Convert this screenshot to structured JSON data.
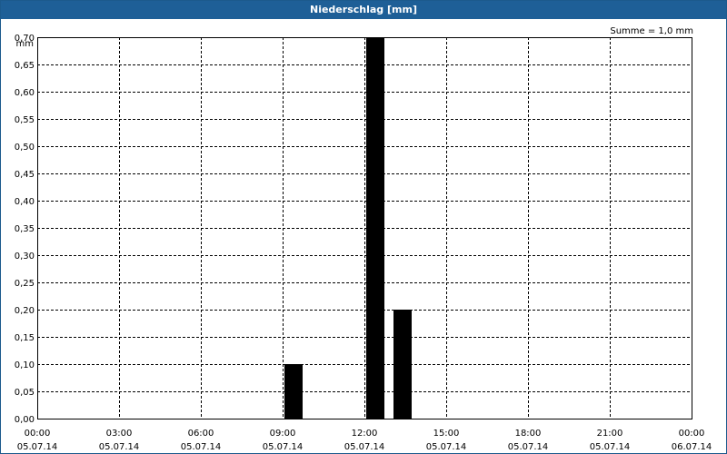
{
  "window": {
    "title": "Niederschlag [mm]"
  },
  "summary": "Summe = 1,0 mm",
  "colors": {
    "titlebar": "#1e5f97",
    "bars": "#000000",
    "grid": "#000000"
  },
  "chart_data": {
    "type": "bar",
    "title": "Niederschlag [mm]",
    "ylabel": "mm",
    "xlabel": "",
    "ylim": [
      0,
      0.7
    ],
    "xlim": [
      "05.07.14 00:00",
      "06.07.14 00:00"
    ],
    "grid": true,
    "yticks": [
      "0,00",
      "0,05",
      "0,10",
      "0,15",
      "0,20",
      "0,25",
      "0,30",
      "0,35",
      "0,40",
      "0,45",
      "0,50",
      "0,55",
      "0,60",
      "0,65",
      "0,70"
    ],
    "xticks": [
      {
        "time": "00:00",
        "date": "05.07.14"
      },
      {
        "time": "03:00",
        "date": "05.07.14"
      },
      {
        "time": "06:00",
        "date": "05.07.14"
      },
      {
        "time": "09:00",
        "date": "05.07.14"
      },
      {
        "time": "12:00",
        "date": "05.07.14"
      },
      {
        "time": "15:00",
        "date": "05.07.14"
      },
      {
        "time": "18:00",
        "date": "05.07.14"
      },
      {
        "time": "21:00",
        "date": "05.07.14"
      },
      {
        "time": "00:00",
        "date": "06.07.14"
      }
    ],
    "bars": [
      {
        "start": "05.07.14 09:00",
        "end": "05.07.14 10:00",
        "value": 0.1
      },
      {
        "start": "05.07.14 12:00",
        "end": "05.07.14 13:00",
        "value": 0.7
      },
      {
        "start": "05.07.14 13:00",
        "end": "05.07.14 14:00",
        "value": 0.2
      }
    ]
  }
}
